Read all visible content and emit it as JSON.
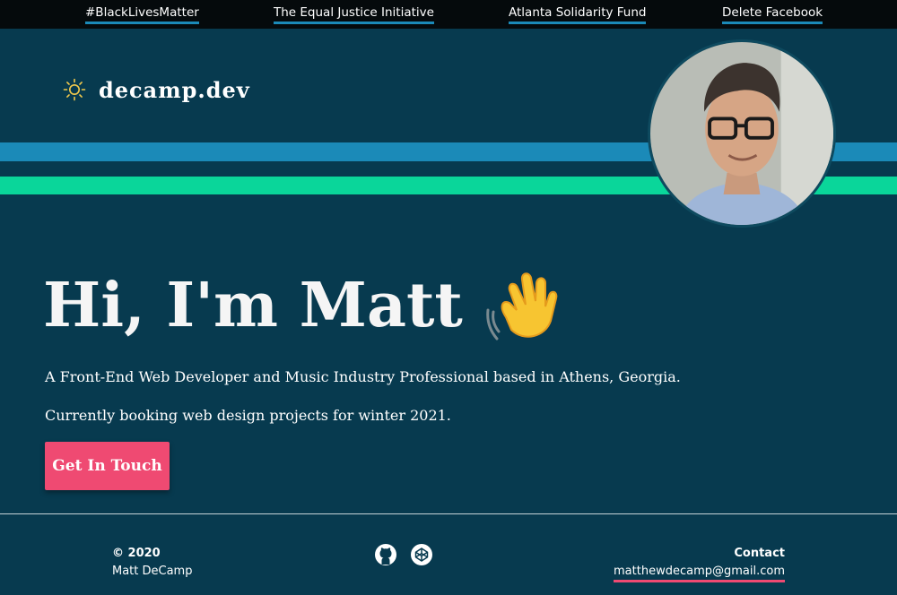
{
  "topbar": {
    "links": [
      {
        "label": "#BlackLivesMatter"
      },
      {
        "label": "The Equal Justice Initiative"
      },
      {
        "label": "Atlanta Solidarity Fund"
      },
      {
        "label": "Delete Facebook"
      }
    ]
  },
  "brand": {
    "name": "decamp.dev",
    "icon": "sun-icon"
  },
  "avatar": {
    "icon": "profile-photo"
  },
  "hero": {
    "title": "Hi, I'm Matt",
    "emoji_icon": "waving-hand-icon",
    "tagline": "A Front-End Web Developer and Music Industry Professional based in Athens, Georgia.",
    "booking": "Currently booking web design projects for winter 2021.",
    "cta_label": "Get In Touch"
  },
  "footer": {
    "copyright_year": "© 2020",
    "copyright_name": "Matt DeCamp",
    "social": [
      {
        "icon": "github-icon"
      },
      {
        "icon": "codepen-icon"
      }
    ],
    "contact_heading": "Contact",
    "contact_email": "matthewdecamp@gmail.com"
  },
  "colors": {
    "background": "#073a4f",
    "topbar": "#050a0c",
    "stripe_blue": "#1b8ab8",
    "stripe_green": "#0ad69a",
    "accent_pink": "#ef4a72",
    "sun": "#f2c94c"
  }
}
